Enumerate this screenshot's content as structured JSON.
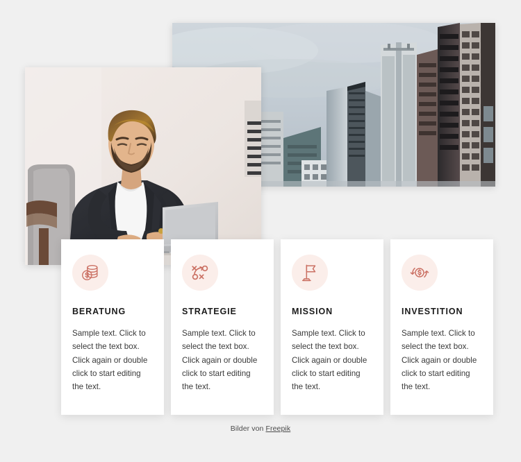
{
  "colors": {
    "page_background": "#f0f0f0",
    "card_background": "#ffffff",
    "icon_accent": "#cb7164",
    "icon_circle_background": "#fbeeea",
    "title_color": "#1b1b1b",
    "body_text_color": "#3a3a3a"
  },
  "images": [
    {
      "name": "cityscape-photo",
      "alt": "Modern glass office skyscrapers against an overcast grey sky"
    },
    {
      "name": "businessman-photo",
      "alt": "Bearded businessman in a dark blazer working on a laptop in a grey armchair"
    }
  ],
  "cards": [
    {
      "icon": "coins-stack-icon",
      "title": "BERATUNG",
      "text": "Sample text. Click to select the text box. Click again or double click to start editing the text."
    },
    {
      "icon": "strategy-xo-icon",
      "title": "STRATEGIE",
      "text": "Sample text. Click to select the text box. Click again or double click to start editing the text."
    },
    {
      "icon": "flag-icon",
      "title": "MISSION",
      "text": "Sample text. Click to select the text box. Click again or double click to start editing the text."
    },
    {
      "icon": "money-refresh-icon",
      "title": "INVESTITION",
      "text": "Sample text. Click to select the text box. Click again or double click to start editing the text."
    }
  ],
  "footer": {
    "prefix": "Bilder von ",
    "link_label": "Freepik"
  }
}
